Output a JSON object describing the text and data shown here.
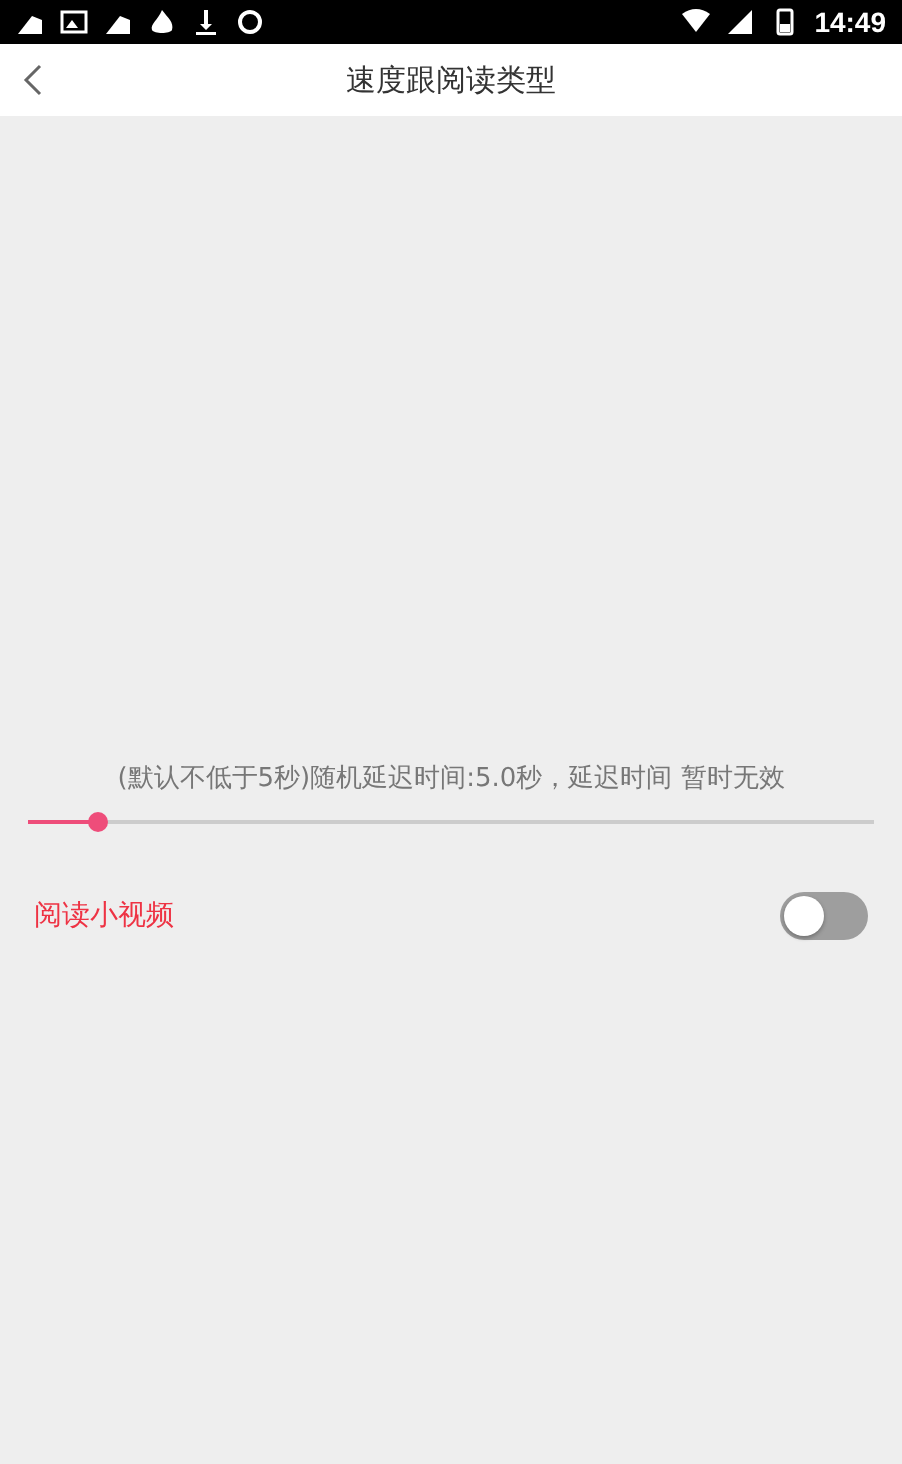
{
  "status_bar": {
    "time": "14:49"
  },
  "header": {
    "title": "速度跟阅读类型"
  },
  "delay": {
    "caption": "(默认不低于5秒)随机延迟时间:5.0秒，延迟时间 暂时无效",
    "level": 0.083
  },
  "settings": [
    {
      "label": "阅读小视频",
      "on": false
    }
  ]
}
